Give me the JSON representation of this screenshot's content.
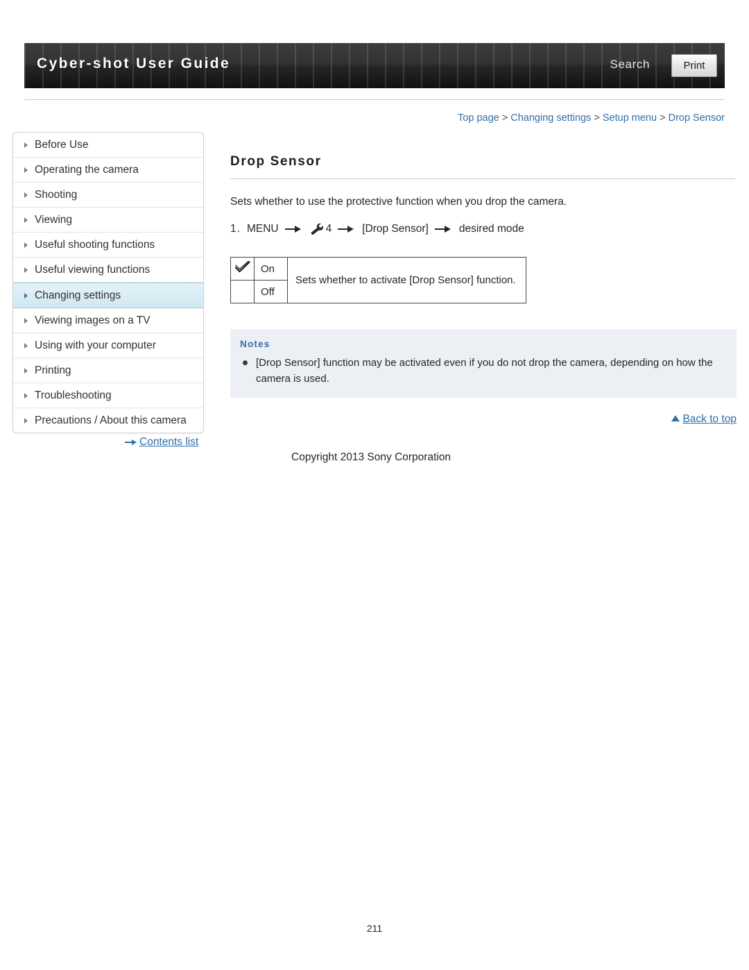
{
  "header": {
    "title": "Cyber-shot User Guide",
    "search_label": "Search",
    "print_label": "Print"
  },
  "breadcrumb": {
    "items": [
      {
        "label": "Top page",
        "link": true
      },
      {
        "label": "Changing settings",
        "link": true
      },
      {
        "label": "Setup menu",
        "link": true
      },
      {
        "label": "Drop Sensor",
        "link": true
      }
    ],
    "separator": ">"
  },
  "sidebar": {
    "items": [
      {
        "label": "Before Use",
        "active": false
      },
      {
        "label": "Operating the camera",
        "active": false
      },
      {
        "label": "Shooting",
        "active": false
      },
      {
        "label": "Viewing",
        "active": false
      },
      {
        "label": "Useful shooting functions",
        "active": false
      },
      {
        "label": "Useful viewing functions",
        "active": false
      },
      {
        "label": "Changing settings",
        "active": true
      },
      {
        "label": "Viewing images on a TV",
        "active": false
      },
      {
        "label": "Using with your computer",
        "active": false
      },
      {
        "label": "Printing",
        "active": false
      },
      {
        "label": "Troubleshooting",
        "active": false
      },
      {
        "label": "Precautions / About this camera",
        "active": false
      }
    ],
    "contents_list_label": "Contents list"
  },
  "main": {
    "title": "Drop Sensor",
    "intro": "Sets whether to use the protective function when you drop the camera.",
    "step": {
      "number": "1.",
      "menu_label": "MENU",
      "setup_number": "4",
      "bracket_item": "[Drop Sensor]",
      "tail": "desired mode"
    },
    "options": {
      "on_label": "On",
      "off_label": "Off",
      "description": "Sets whether to activate [Drop Sensor] function."
    },
    "notes": {
      "title": "Notes",
      "items": [
        "[Drop Sensor] function may be activated even if you do not drop the camera, depending on how the camera is used."
      ]
    },
    "back_to_top": "Back to top"
  },
  "footer": {
    "copyright": "Copyright 2013 Sony Corporation",
    "page_number": "211"
  }
}
